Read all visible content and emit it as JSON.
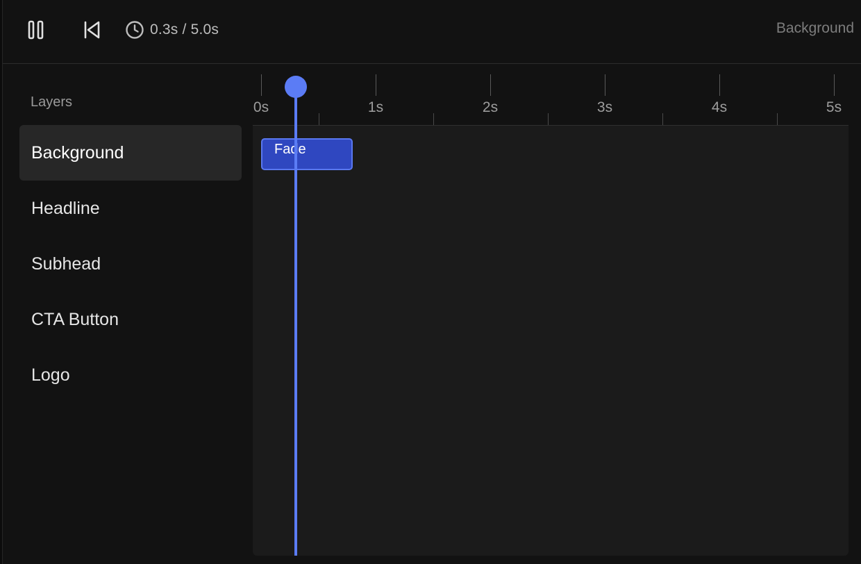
{
  "toolbar": {
    "pause_icon": "pause-icon",
    "restart_icon": "skip-to-start-icon",
    "clock_icon": "clock-icon",
    "time_display": "0.3s / 5.0s",
    "selected_layer": "Background"
  },
  "layers": {
    "title": "Layers",
    "items": [
      {
        "label": "Background",
        "active": true
      },
      {
        "label": "Headline",
        "active": false
      },
      {
        "label": "Subhead",
        "active": false
      },
      {
        "label": "CTA Button",
        "active": false
      },
      {
        "label": "Logo",
        "active": false
      }
    ]
  },
  "timeline": {
    "current_time_s": 0.3,
    "duration_s": 5.0,
    "ruler_labels": [
      "0s",
      "1s",
      "2s",
      "3s",
      "4s",
      "5s"
    ],
    "clips": [
      {
        "label": "Fade",
        "layer": "Background",
        "start_s": 0,
        "end_s": 0.8
      }
    ],
    "colors": {
      "accent": "#5b7cf5",
      "clip_fill": "#2f47c0",
      "clip_border": "#5a78f0"
    }
  }
}
